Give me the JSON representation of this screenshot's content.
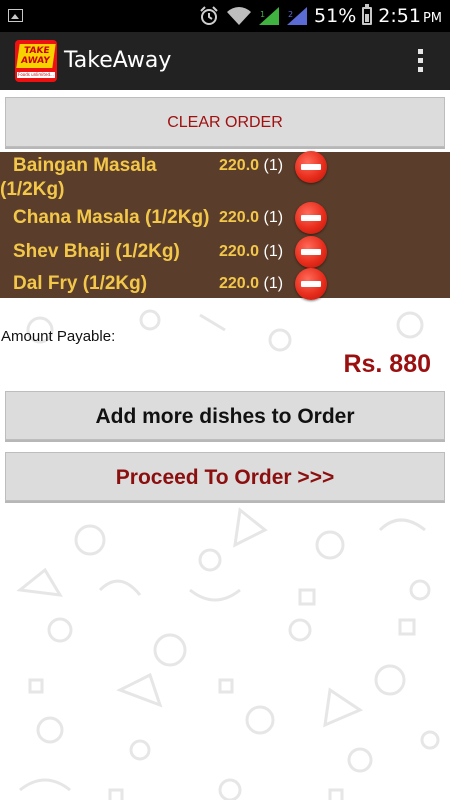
{
  "status_bar": {
    "battery_percent": "51%",
    "time": "2:51",
    "ampm": "PM",
    "icons": [
      "image-icon",
      "alarm-icon",
      "wifi-icon",
      "signal-icon",
      "signal-icon-2",
      "battery-icon"
    ]
  },
  "app_bar": {
    "title": "TakeAway",
    "logo_text_top": "TAKE AWAY",
    "logo_text_bottom": "Foods unlimited...",
    "overflow_icon": "overflow-menu-icon"
  },
  "clear_button": {
    "label": "CLEAR ORDER"
  },
  "order": {
    "items": [
      {
        "name_line1": "Baingan Masala",
        "name_line2": "(1/2Kg)",
        "price": "220.0",
        "qty": "(1)"
      },
      {
        "name": "Chana Masala (1/2Kg)",
        "price": "220.0",
        "qty": "(1)"
      },
      {
        "name": "Shev Bhaji (1/2Kg)",
        "price": "220.0",
        "qty": "(1)"
      },
      {
        "name": "Dal Fry (1/2Kg)",
        "price": "220.0",
        "qty": "(1)"
      }
    ],
    "remove_icon": "remove-icon"
  },
  "amount": {
    "label": "Amount Payable:",
    "value": "Rs. 880"
  },
  "add_button": {
    "label": "Add more dishes to Order"
  },
  "proceed_button": {
    "label": "Proceed To Order >>>"
  },
  "colors": {
    "panel_bg": "#5a3d2b",
    "item_text": "#f3c84a",
    "accent_red": "#9a1010",
    "button_bg": "#dcdcdc"
  }
}
